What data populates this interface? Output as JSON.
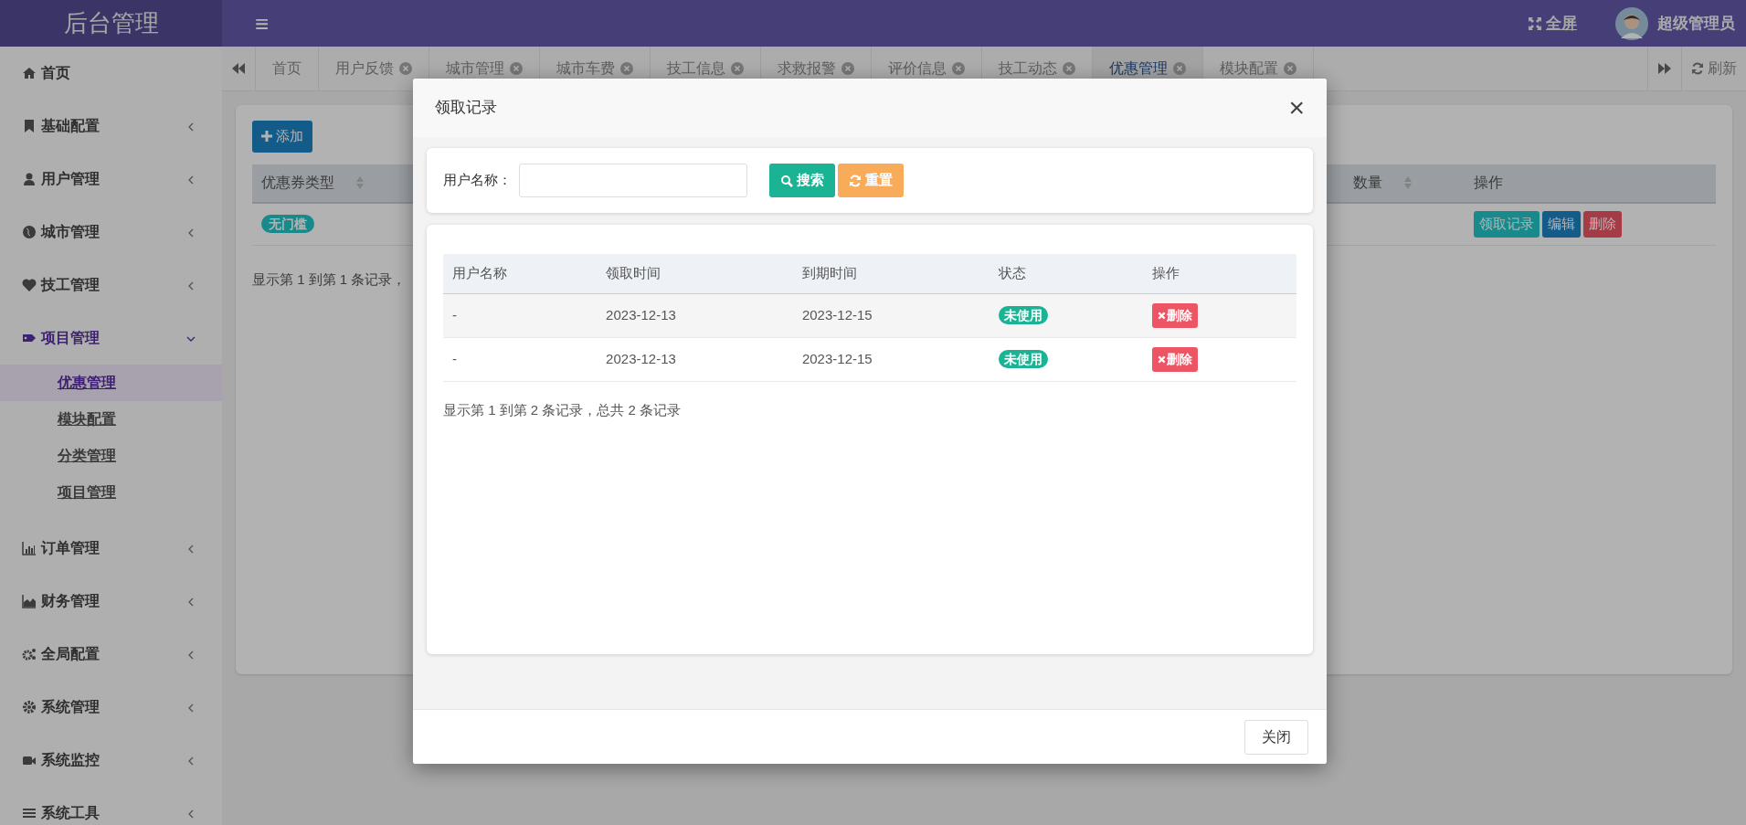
{
  "header": {
    "logo": "后台管理",
    "menu_toggle": "≡",
    "fullscreen": "全屏",
    "user": "超级管理员"
  },
  "sidebar": {
    "items": [
      {
        "label": "首页"
      },
      {
        "label": "基础配置",
        "expanded": false
      },
      {
        "label": "用户管理",
        "expanded": false
      },
      {
        "label": "城市管理",
        "expanded": false
      },
      {
        "label": "技工管理",
        "expanded": false
      },
      {
        "label": "项目管理",
        "expanded": true,
        "children": [
          {
            "label": "优惠管理",
            "selected": true
          },
          {
            "label": "模块配置",
            "selected": false
          },
          {
            "label": "分类管理",
            "selected": false
          },
          {
            "label": "项目管理",
            "selected": false
          }
        ]
      },
      {
        "label": "订单管理",
        "expanded": false
      },
      {
        "label": "财务管理",
        "expanded": false
      },
      {
        "label": "全局配置",
        "expanded": false
      },
      {
        "label": "系统管理",
        "expanded": false
      },
      {
        "label": "系统监控",
        "expanded": false
      },
      {
        "label": "系统工具",
        "expanded": false
      }
    ]
  },
  "tabs": [
    {
      "label": "首页",
      "closable": false,
      "selected": false
    },
    {
      "label": "用户反馈",
      "closable": true,
      "selected": false
    },
    {
      "label": "城市管理",
      "closable": true,
      "selected": false
    },
    {
      "label": "城市车费",
      "closable": true,
      "selected": false
    },
    {
      "label": "技工信息",
      "closable": true,
      "selected": false
    },
    {
      "label": "求救报警",
      "closable": true,
      "selected": false
    },
    {
      "label": "评价信息",
      "closable": true,
      "selected": false
    },
    {
      "label": "技工动态",
      "closable": true,
      "selected": false
    },
    {
      "label": "优惠管理",
      "closable": true,
      "selected": true
    },
    {
      "label": "模块配置",
      "closable": true,
      "selected": false
    }
  ],
  "refresh": "刷新",
  "main": {
    "add_button": "添加",
    "table": {
      "columns": [
        {
          "label": "优惠券类型",
          "sortable": true
        },
        {
          "label": "数量",
          "sortable": true
        },
        {
          "label": "操作",
          "sortable": false
        }
      ],
      "rows": [
        {
          "type": "无门槛",
          "actions": [
            {
              "label": "领取记录",
              "kind": "info"
            },
            {
              "label": "编辑",
              "kind": "primary"
            },
            {
              "label": "删除",
              "kind": "danger"
            }
          ]
        }
      ]
    },
    "pagination": "显示第 1 到第 1 条记录，"
  },
  "modal": {
    "title": "领取记录",
    "close": "×",
    "search": {
      "label": "用户名称：",
      "search_button": "搜索",
      "reset_button": "重置"
    },
    "table": {
      "columns": [
        "用户名称",
        "领取时间",
        "到期时间",
        "状态",
        "操作"
      ],
      "rows": [
        {
          "user": "-",
          "received": "2023-12-13",
          "expires": "2023-12-15",
          "status": "未使用",
          "action": "删除"
        },
        {
          "user": "-",
          "received": "2023-12-13",
          "expires": "2023-12-15",
          "status": "未使用",
          "action": "删除"
        }
      ]
    },
    "pagination": "显示第 1 到第 2 条记录，总共 2 条记录",
    "footer_button": "关闭"
  }
}
